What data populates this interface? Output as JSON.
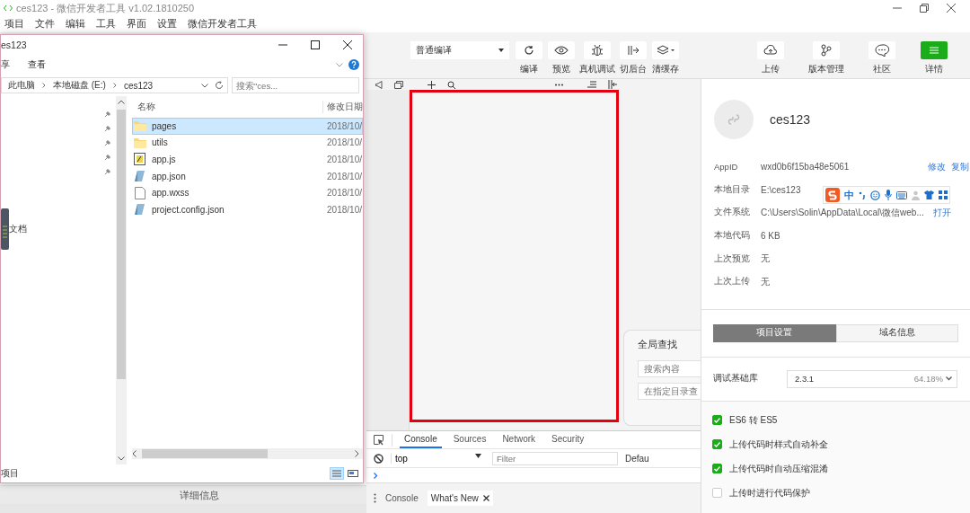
{
  "ide": {
    "title": "ces123 - 微信开发者工具 v1.02.1810250",
    "menu": [
      "项目",
      "文件",
      "编辑",
      "工具",
      "界面",
      "设置",
      "微信开发者工具"
    ],
    "compile_mode": "普通编译",
    "toolbar_left": [
      {
        "kind": "refresh",
        "label": "编译"
      },
      {
        "kind": "eye",
        "label": "预览"
      },
      {
        "kind": "bug",
        "label": "真机调试"
      },
      {
        "kind": "switch",
        "label": "切后台"
      },
      {
        "kind": "layers",
        "label": "清缓存"
      }
    ],
    "toolbar_right": [
      {
        "kind": "cloud",
        "label": "上传",
        "selected": false
      },
      {
        "kind": "branch",
        "label": "版本管理",
        "selected": false
      },
      {
        "kind": "chat",
        "label": "社区",
        "selected": false
      },
      {
        "kind": "menu",
        "label": "详情",
        "selected": true
      }
    ],
    "editor_footer": "详细信息",
    "global_search": {
      "title": "全局查找",
      "fields": [
        {
          "placeholder": "搜索内容"
        },
        {
          "placeholder": "在指定目录查"
        }
      ]
    },
    "devtools": {
      "tabs": [
        {
          "label": "Console",
          "selected": true
        },
        {
          "label": "Sources",
          "selected": false
        },
        {
          "label": "Network",
          "selected": false
        },
        {
          "label": "Security",
          "selected": false
        }
      ],
      "context": "top",
      "filter_placeholder": "Filter",
      "levels": "Defau",
      "drawer_tabs": [
        {
          "label": "Console",
          "selected": false,
          "closable": false
        },
        {
          "label": "What's New",
          "selected": true,
          "closable": true
        }
      ]
    },
    "details": {
      "name": "ces123",
      "rows": [
        {
          "label": "AppID",
          "value": "wxd0b6f15ba48e5061",
          "links": [
            "修改",
            "复制"
          ]
        },
        {
          "label": "本地目录",
          "value": "E:\\ces123"
        },
        {
          "label": "文件系统",
          "value": "C:\\Users\\Solin\\AppData\\Local\\微信web...",
          "links": [
            "打开"
          ]
        },
        {
          "label": "本地代码",
          "value": "6 KB"
        },
        {
          "label": "上次预览",
          "value": "无"
        },
        {
          "label": "上次上传",
          "value": "无"
        }
      ],
      "tabs": [
        {
          "label": "项目设置",
          "selected": true
        },
        {
          "label": "域名信息",
          "selected": false
        }
      ],
      "base_library": {
        "label": "调试基础库",
        "version": "2.3.1",
        "share": "64.18%"
      },
      "options": [
        {
          "label": "ES6 转 ES5",
          "checked": true
        },
        {
          "label": "上传代码时样式自动补全",
          "checked": true
        },
        {
          "label": "上传代码时自动压缩混淆",
          "checked": true
        },
        {
          "label": "上传时进行代码保护",
          "checked": false
        }
      ]
    },
    "ime_bar": {
      "mode": "中"
    }
  },
  "explorer": {
    "title": "es123",
    "ribbon_tabs": [
      "享",
      "查看"
    ],
    "path": [
      "此电脑",
      "本地磁盘 (E:)",
      "ces123"
    ],
    "search_placeholder": "搜索\"ces...",
    "nav_items": [
      "文档"
    ],
    "columns": [
      "名称",
      "修改日期"
    ],
    "files": [
      {
        "kind": "folder",
        "name": "pages",
        "date": "2018/10/",
        "selected": true
      },
      {
        "kind": "folder",
        "name": "utils",
        "date": "2018/10/",
        "selected": false
      },
      {
        "kind": "script",
        "name": "app.js",
        "date": "2018/10/",
        "selected": false
      },
      {
        "kind": "json",
        "name": "app.json",
        "date": "2018/10/",
        "selected": false
      },
      {
        "kind": "blank",
        "name": "app.wxss",
        "date": "2018/10/",
        "selected": false
      },
      {
        "kind": "json",
        "name": "project.config.json",
        "date": "2018/10/",
        "selected": false
      }
    ],
    "status": "项目"
  }
}
